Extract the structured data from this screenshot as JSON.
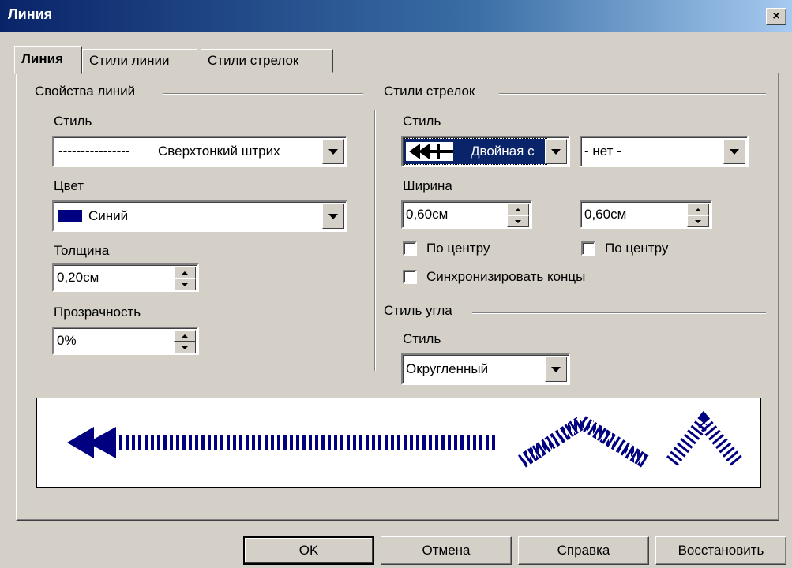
{
  "window": {
    "title": "Линия",
    "close_glyph": "×"
  },
  "tabs": [
    {
      "label": "Линия",
      "active": true
    },
    {
      "label": "Стили линии",
      "active": false
    },
    {
      "label": "Стили стрелок",
      "active": false
    }
  ],
  "line_props": {
    "group": "Свойства линий",
    "style_label": "Стиль",
    "style_value": "Сверхтонкий штрих",
    "style_dashes": "----------------",
    "color_label": "Цвет",
    "color_value": "Синий",
    "color_swatch": "#000080",
    "width_label": "Толщина",
    "width_value": "0,20см",
    "transparency_label": "Прозрачность",
    "transparency_value": "0%"
  },
  "arrow_styles": {
    "group": "Стили стрелок",
    "style_label": "Стиль",
    "start_value": "Двойная с",
    "end_value": "- нет -",
    "width_label": "Ширина",
    "start_width": "0,60см",
    "end_width": "0,60см",
    "start_center": "По центру",
    "end_center": "По центру",
    "sync": "Синхронизировать концы"
  },
  "corner_style": {
    "group": "Стиль угла",
    "style_label": "Стиль",
    "value": "Округленный"
  },
  "buttons": {
    "ok": "OK",
    "cancel": "Отмена",
    "help": "Справка",
    "reset": "Восстановить"
  },
  "colors": {
    "line_color": "#000080",
    "selection": "#0a246a"
  }
}
